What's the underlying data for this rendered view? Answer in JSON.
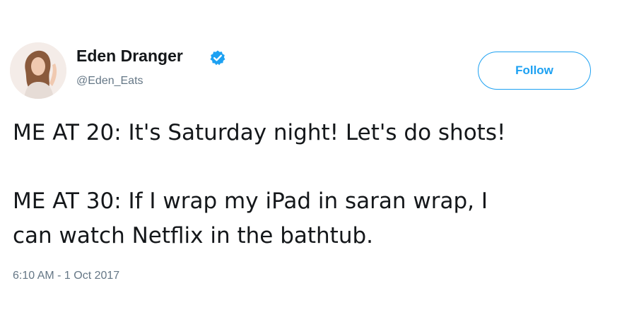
{
  "user": {
    "display_name": "Eden Dranger",
    "handle": "@Eden_Eats",
    "verified": true
  },
  "actions": {
    "follow_label": "Follow"
  },
  "tweet": {
    "line1": "ME AT 20: It's Saturday night! Let's do shots!",
    "line2": "ME AT 30: If I wrap my iPad in saran wrap, I",
    "line3": "can watch Netflix in the bathtub.",
    "timestamp": "6:10 AM - 1 Oct 2017"
  },
  "colors": {
    "accent": "#1da1f2",
    "text": "#14171a",
    "muted": "#657786"
  },
  "icons": {
    "verified": "verified-badge-icon",
    "avatar": "profile-avatar"
  }
}
